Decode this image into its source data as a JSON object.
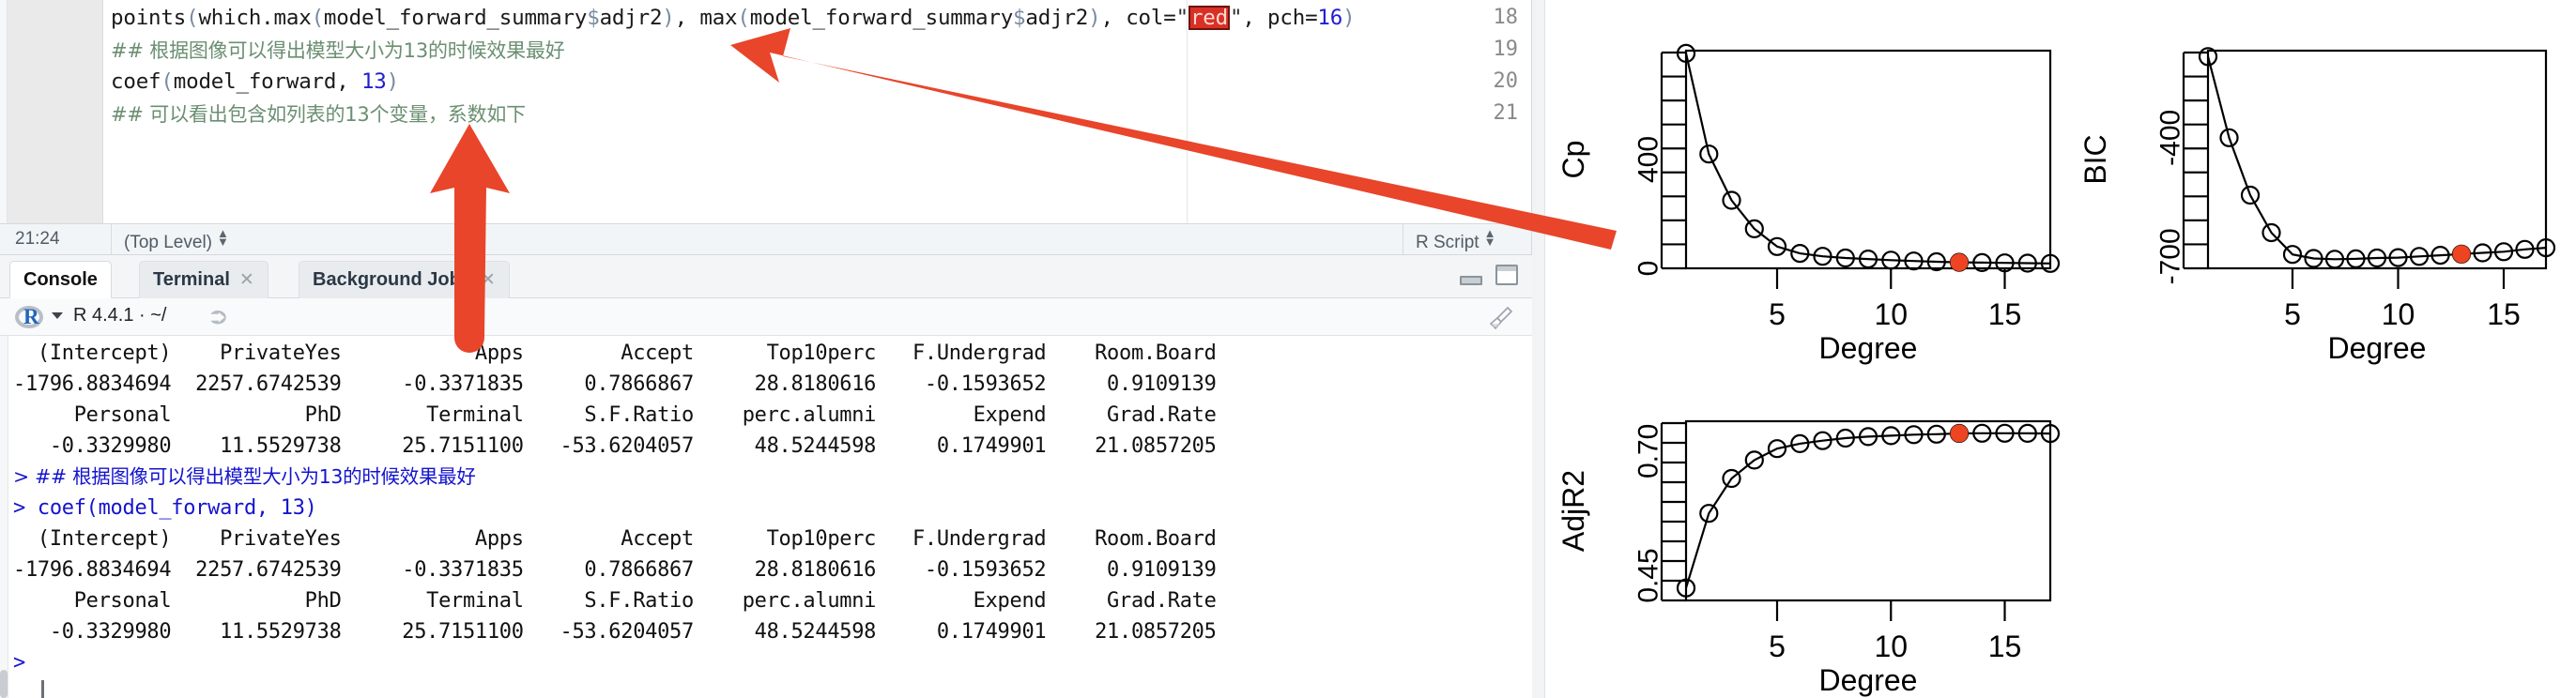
{
  "editor": {
    "lines": [
      {
        "num": "18",
        "type": "code",
        "segments": [
          {
            "t": "points",
            "c": "plain"
          },
          {
            "t": "(",
            "c": "paren"
          },
          {
            "t": "which.max",
            "c": "plain"
          },
          {
            "t": "(",
            "c": "paren"
          },
          {
            "t": "model_forward_summary",
            "c": "plain"
          },
          {
            "t": "$",
            "c": "dollar"
          },
          {
            "t": "adjr2",
            "c": "plain"
          },
          {
            "t": ")",
            "c": "paren"
          },
          {
            "t": ", ",
            "c": "plain"
          },
          {
            "t": "max",
            "c": "plain"
          },
          {
            "t": "(",
            "c": "paren"
          },
          {
            "t": "model_forward_summary",
            "c": "plain"
          },
          {
            "t": "$",
            "c": "dollar"
          },
          {
            "t": "adjr2",
            "c": "plain"
          },
          {
            "t": ")",
            "c": "paren"
          },
          {
            "t": ", col=",
            "c": "plain"
          },
          {
            "t": "\"",
            "c": "str"
          },
          {
            "t": "red",
            "c": "colorchip"
          },
          {
            "t": "\"",
            "c": "str"
          },
          {
            "t": ", pch=",
            "c": "plain"
          },
          {
            "t": "16",
            "c": "num"
          },
          {
            "t": ")",
            "c": "paren"
          }
        ],
        "plain_text": "points(which.max(model_forward_summary$adjr2), max(model_forward_summary$adjr2), col=\"red\", pch=16)"
      },
      {
        "num": "19",
        "type": "comment",
        "text": "## 根据图像可以得出模型大小为13的时候效果最好"
      },
      {
        "num": "20",
        "type": "code",
        "segments": [
          {
            "t": "coef",
            "c": "plain"
          },
          {
            "t": "(",
            "c": "paren"
          },
          {
            "t": "model_forward, ",
            "c": "plain"
          },
          {
            "t": "13",
            "c": "num"
          },
          {
            "t": ")",
            "c": "paren"
          }
        ],
        "plain_text": "coef(model_forward, 13)"
      },
      {
        "num": "21",
        "type": "comment",
        "text": "## 可以看出包含如列表的13个变量，系数如下"
      }
    ],
    "statusbar": {
      "cursor_position": "21:24",
      "scope": "(Top Level)",
      "file_type": "R Script"
    }
  },
  "console": {
    "tabs": [
      {
        "label": "Console",
        "active": true,
        "closable": false
      },
      {
        "label": "Terminal",
        "active": false,
        "closable": true
      },
      {
        "label": "Background Jobs",
        "active": false,
        "closable": true
      }
    ],
    "window_buttons": [
      "minimize-icon",
      "maximize-icon"
    ],
    "toolbar": {
      "r_logo": "r-logo-icon",
      "dropdown": "chevron-down-icon",
      "version_text": "R 4.4.1 · ~/",
      "popout": "share-arrow-icon",
      "broom": "broom-icon"
    },
    "output_lines": [
      {
        "type": "out",
        "text": "  (Intercept)    PrivateYes           Apps        Accept      Top10perc   F.Undergrad    Room.Board"
      },
      {
        "type": "out",
        "text": "-1796.8834694  2257.6742539     -0.3371835     0.7866867     28.8180616    -0.1593652     0.9109139"
      },
      {
        "type": "out",
        "text": "     Personal           PhD       Terminal     S.F.Ratio    perc.alumni        Expend     Grad.Rate"
      },
      {
        "type": "out",
        "text": "   -0.3329980    11.5529738     25.7151100   -53.6204057     48.5244598     0.1749901    21.0857205"
      },
      {
        "type": "cmd",
        "text": "> ## 根据图像可以得出模型大小为13的时候效果最好"
      },
      {
        "type": "cmd",
        "text": "> coef(model_forward, 13)"
      },
      {
        "type": "out",
        "text": "  (Intercept)    PrivateYes           Apps        Accept      Top10perc   F.Undergrad    Room.Board"
      },
      {
        "type": "out",
        "text": "-1796.8834694  2257.6742539     -0.3371835     0.7866867     28.8180616    -0.1593652     0.9109139"
      },
      {
        "type": "out",
        "text": "     Personal           PhD       Terminal     S.F.Ratio    perc.alumni        Expend     Grad.Rate"
      },
      {
        "type": "out",
        "text": "   -0.3329980    11.5529738     25.7151100   -53.6204057     48.5244598     0.1749901    21.0857205"
      },
      {
        "type": "cmd",
        "text": ">"
      }
    ]
  },
  "colors": {
    "annotation_red": "#E8452B",
    "highlight_red": "#D93025",
    "comment_green": "#6B8F72",
    "console_blue": "#1414CF",
    "plot_point_red": "#EE4422"
  },
  "annotations": [
    {
      "name": "arrow-to-comment-line-19",
      "type": "arrow",
      "direction": "up-left",
      "tip_x": 778,
      "tip_y": 48,
      "tail_x": 1716,
      "tail_y": 266
    },
    {
      "name": "arrow-to-console-tabs",
      "type": "arrow",
      "direction": "up",
      "tip_x": 500,
      "tip_y": 132,
      "tail_x": 500,
      "tail_y": 366
    }
  ],
  "chart_data": [
    {
      "name": "cp-plot",
      "type": "line",
      "title": "",
      "xlabel": "Degree",
      "ylabel": "Cp",
      "xlim": [
        1,
        17
      ],
      "ylim": [
        0,
        800
      ],
      "xticks": [
        5,
        10,
        15
      ],
      "xticklabels": [
        "5",
        "10",
        "15"
      ],
      "yticks": [
        0,
        400
      ],
      "yticklabels": [
        "0",
        "400"
      ],
      "grid": false,
      "legend": "none",
      "x": [
        1,
        2,
        3,
        4,
        5,
        6,
        7,
        8,
        9,
        10,
        11,
        12,
        13,
        14,
        15,
        16,
        17
      ],
      "values": [
        790,
        420,
        250,
        145,
        80,
        55,
        44,
        38,
        34,
        30,
        27,
        24,
        22,
        21,
        20,
        19,
        18
      ],
      "highlight": {
        "x": 13,
        "y": 22,
        "color": "#EE4422",
        "style": "filled-circle"
      },
      "marker": "open-circle"
    },
    {
      "name": "bic-plot",
      "type": "line",
      "title": "",
      "xlabel": "Degree",
      "ylabel": "BIC",
      "xlim": [
        1,
        17
      ],
      "ylim": [
        -730,
        -180
      ],
      "xticks": [
        5,
        10,
        15
      ],
      "xticklabels": [
        "5",
        "10",
        "15"
      ],
      "yticks": [
        -700,
        -400
      ],
      "yticklabels": [
        "-700",
        "-400"
      ],
      "grid": false,
      "legend": "none",
      "x": [
        1,
        2,
        3,
        4,
        5,
        6,
        7,
        8,
        9,
        10,
        11,
        12,
        13,
        14,
        15,
        16,
        17
      ],
      "values": [
        -195,
        -400,
        -545,
        -640,
        -695,
        -705,
        -707,
        -706,
        -704,
        -703,
        -700,
        -697,
        -694,
        -691,
        -688,
        -682,
        -678
      ],
      "highlight": {
        "x": 13,
        "y": -694,
        "color": "#EE4422",
        "style": "filled-circle"
      },
      "marker": "open-circle"
    },
    {
      "name": "adjr2-plot",
      "type": "line",
      "title": "",
      "xlabel": "Degree",
      "ylabel": "AdjR2",
      "xlim": [
        1,
        17
      ],
      "ylim": [
        0.4,
        0.76
      ],
      "xticks": [
        5,
        10,
        15
      ],
      "xticklabels": [
        "5",
        "10",
        "15"
      ],
      "yticks": [
        0.45,
        0.7
      ],
      "yticklabels": [
        "0.45",
        "0.70"
      ],
      "grid": false,
      "legend": "none",
      "x": [
        1,
        2,
        3,
        4,
        5,
        6,
        7,
        8,
        9,
        10,
        11,
        12,
        13,
        14,
        15,
        16,
        17
      ],
      "values": [
        0.425,
        0.575,
        0.645,
        0.682,
        0.705,
        0.715,
        0.721,
        0.726,
        0.729,
        0.731,
        0.733,
        0.734,
        0.7355,
        0.7358,
        0.7358,
        0.7357,
        0.7353
      ],
      "highlight": {
        "x": 13,
        "y": 0.7355,
        "color": "#EE4422",
        "style": "filled-circle"
      },
      "marker": "open-circle"
    }
  ]
}
